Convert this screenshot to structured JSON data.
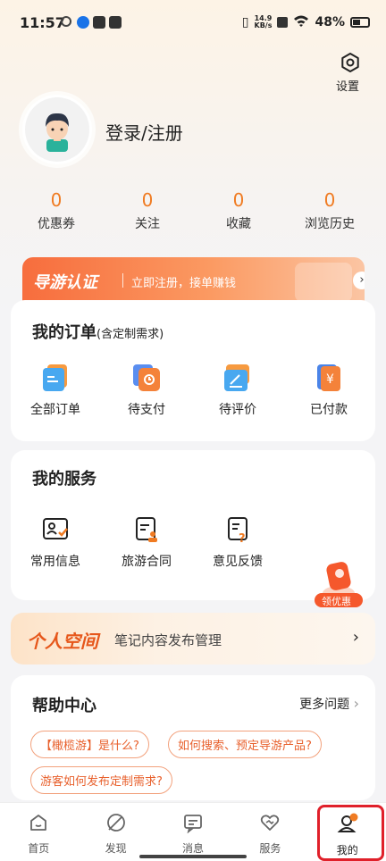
{
  "status_bar": {
    "time": "11:57",
    "net_speed": "14.9\nKB/s",
    "battery": "48%"
  },
  "header": {
    "settings_label": "设置",
    "login_label": "登录/注册"
  },
  "stats": [
    {
      "value": "0",
      "label": "优惠券"
    },
    {
      "value": "0",
      "label": "关注"
    },
    {
      "value": "0",
      "label": "收藏"
    },
    {
      "value": "0",
      "label": "浏览历史"
    }
  ],
  "guide_banner": {
    "title": "导游认证",
    "subtitle": "立即注册，接单赚钱"
  },
  "orders": {
    "title": "我的订单",
    "subtitle": "(含定制需求)",
    "items": [
      {
        "label": "全部订单",
        "icon": "all-orders-icon"
      },
      {
        "label": "待支付",
        "icon": "pending-payment-icon"
      },
      {
        "label": "待评价",
        "icon": "pending-review-icon"
      },
      {
        "label": "已付款",
        "icon": "paid-icon"
      }
    ]
  },
  "services": {
    "title": "我的服务",
    "items": [
      {
        "label": "常用信息",
        "icon": "contact-card-icon"
      },
      {
        "label": "旅游合同",
        "icon": "contract-icon"
      },
      {
        "label": "意见反馈",
        "icon": "feedback-icon"
      }
    ]
  },
  "coupon_float": {
    "label": "领优惠"
  },
  "personal_space": {
    "title": "个人空间",
    "subtitle": "笔记内容发布管理"
  },
  "help": {
    "title": "帮助中心",
    "more": "更多问题",
    "tags": [
      "【橄榄游】是什么?",
      "如何搜索、预定导游产品?",
      "游客如何发布定制需求?"
    ]
  },
  "nav": {
    "items": [
      {
        "label": "首页",
        "icon": "home-icon"
      },
      {
        "label": "发现",
        "icon": "discover-icon"
      },
      {
        "label": "消息",
        "icon": "message-icon"
      },
      {
        "label": "服务",
        "icon": "service-icon"
      },
      {
        "label": "我的",
        "icon": "profile-icon"
      }
    ],
    "active": "我的"
  },
  "colors": {
    "accent": "#f07b22",
    "banner_start": "#f76d3d",
    "tag": "#e8602c",
    "highlight_box": "#e0202a"
  }
}
